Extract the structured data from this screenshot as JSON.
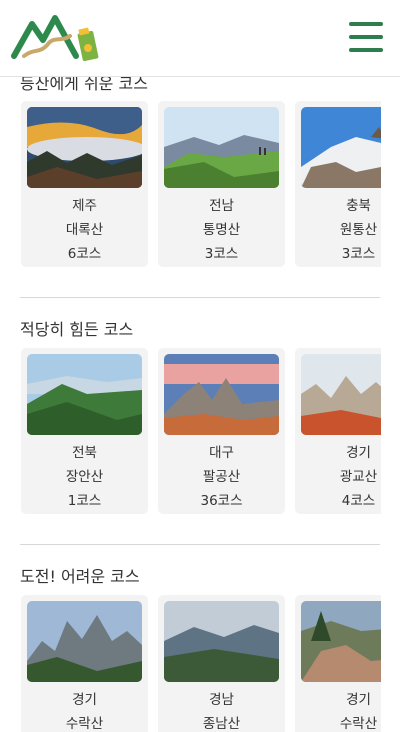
{
  "header": {
    "logo_icon": "mountain-trail-logo",
    "menu_icon": "hamburger-menu-icon",
    "brand_green": "#2e7d4f"
  },
  "sections": [
    {
      "title": "등산에게 쉬운 코스",
      "cards": [
        {
          "region": "제주",
          "mountain": "대록산",
          "courses": "6코스",
          "scene": "clouds-sunset"
        },
        {
          "region": "전남",
          "mountain": "통명산",
          "courses": "3코스",
          "scene": "green-summit"
        },
        {
          "region": "충북",
          "mountain": "원통산",
          "courses": "3코스",
          "scene": "snow-ridge"
        }
      ]
    },
    {
      "title": "적당히 힘든 코스",
      "cards": [
        {
          "region": "전북",
          "mountain": "장안산",
          "courses": "1코스",
          "scene": "green-ridges"
        },
        {
          "region": "대구",
          "mountain": "팔공산",
          "courses": "36코스",
          "scene": "rock-peaks-sunset"
        },
        {
          "region": "경기",
          "mountain": "광교산",
          "courses": "4코스",
          "scene": "autumn-rocks"
        }
      ]
    },
    {
      "title": "도전! 어려운 코스",
      "cards": [
        {
          "region": "경기",
          "mountain": "수락산",
          "courses": "",
          "scene": "rocky-peaks"
        },
        {
          "region": "경남",
          "mountain": "종남산",
          "courses": "",
          "scene": "mountain-range"
        },
        {
          "region": "경기",
          "mountain": "수락산",
          "courses": "",
          "scene": "pine-rock"
        }
      ]
    }
  ]
}
